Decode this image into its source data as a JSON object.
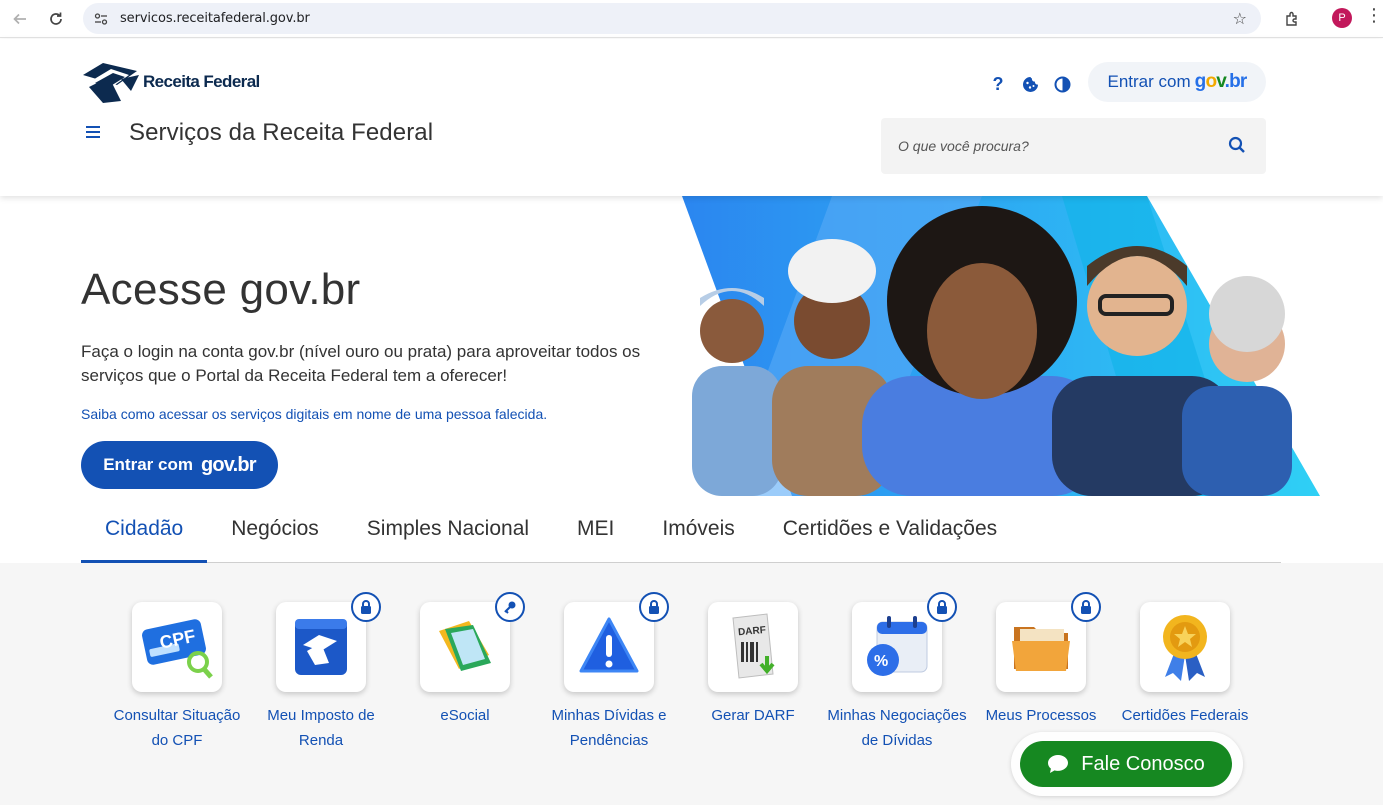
{
  "browser": {
    "url": "servicos.receitafederal.gov.br",
    "profile_initial": "P"
  },
  "header": {
    "logo_text": "Receita Federal",
    "site_title": "Serviços da Receita Federal",
    "help_symbol": "?",
    "login_prefix": "Entrar com",
    "govbr": [
      "g",
      "o",
      "v",
      ".",
      "br"
    ],
    "search_placeholder": "O que você procura?"
  },
  "hero": {
    "title": "Acesse gov.br",
    "description": "Faça o login na conta gov.br (nível ouro ou prata) para aproveitar todos os serviços que o Portal da Receita Federal tem a oferecer!",
    "link": "Saiba como acessar os serviços digitais em nome de uma pessoa falecida.",
    "button_prefix": "Entrar com",
    "button_brand": "gov.br"
  },
  "tabs": [
    "Cidadão",
    "Negócios",
    "Simples Nacional",
    "MEI",
    "Imóveis",
    "Certidões e Validações"
  ],
  "services": [
    {
      "label": "Consultar Situação do CPF",
      "badge": "none"
    },
    {
      "label": "Meu Imposto de Renda",
      "badge": "lock"
    },
    {
      "label": "eSocial",
      "badge": "key"
    },
    {
      "label": "Minhas Dívidas e Pendências",
      "badge": "lock"
    },
    {
      "label": "Gerar DARF",
      "badge": "none"
    },
    {
      "label": "Minhas Negociações de Dívidas",
      "badge": "lock"
    },
    {
      "label": "Meus Processos",
      "badge": "lock"
    },
    {
      "label": "Certidões Federais",
      "badge": "none"
    }
  ],
  "icon_texts": {
    "cpf": "CPF",
    "darf": "DARF",
    "percent": "%"
  },
  "chat": {
    "label": "Fale Conosco"
  },
  "colors": {
    "primary": "#1351b4",
    "chat_green": "#168821",
    "navy": "#0c2a4f"
  }
}
